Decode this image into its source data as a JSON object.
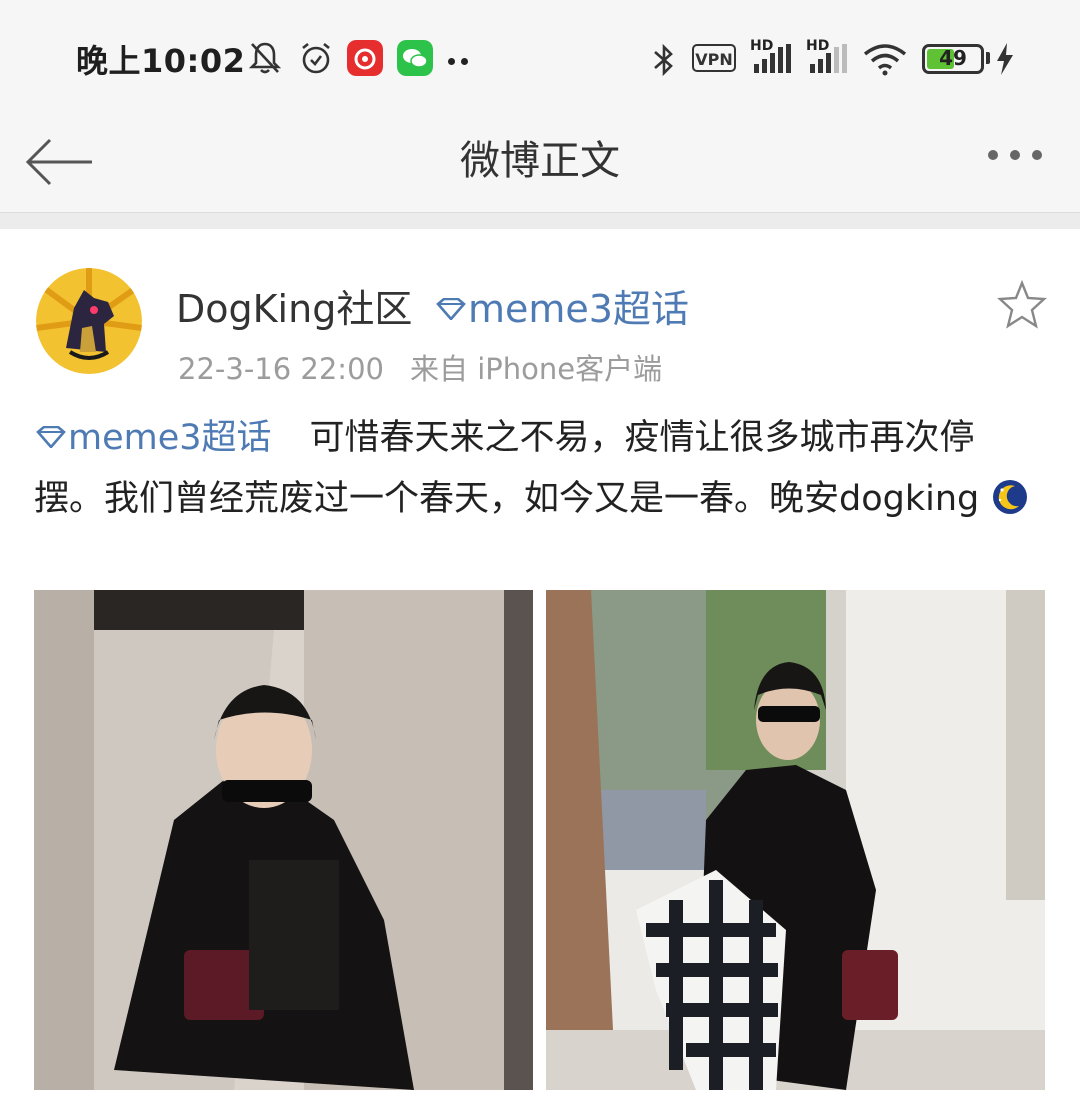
{
  "status_bar": {
    "time": "晚上10:02",
    "vpn_label": "VPN",
    "hd1": "HD",
    "hd2": "HD",
    "battery_level": "49",
    "icons": [
      "bell-off-icon",
      "alarm-icon",
      "netease-music-icon",
      "wechat-icon",
      "bluetooth-icon",
      "signal-icon",
      "wifi-icon",
      "charging-icon"
    ]
  },
  "navbar": {
    "title": "微博正文"
  },
  "post": {
    "author": "DogKing社区",
    "topic_tag": "meme3超话",
    "date": "22-3-16 22:00",
    "source": "来自 iPhone客户端",
    "text_topic": "meme3超话",
    "text_body": "可惜春天来之不易，疫情让很多城市再次停摆。我们曾经荒废过一个春天，如今又是一春。晚安dogking",
    "emoji": "moon-emoji"
  },
  "colors": {
    "link": "#4f7bb4",
    "meta": "#9c9c9c",
    "bar_bg": "#f6f6f6"
  }
}
